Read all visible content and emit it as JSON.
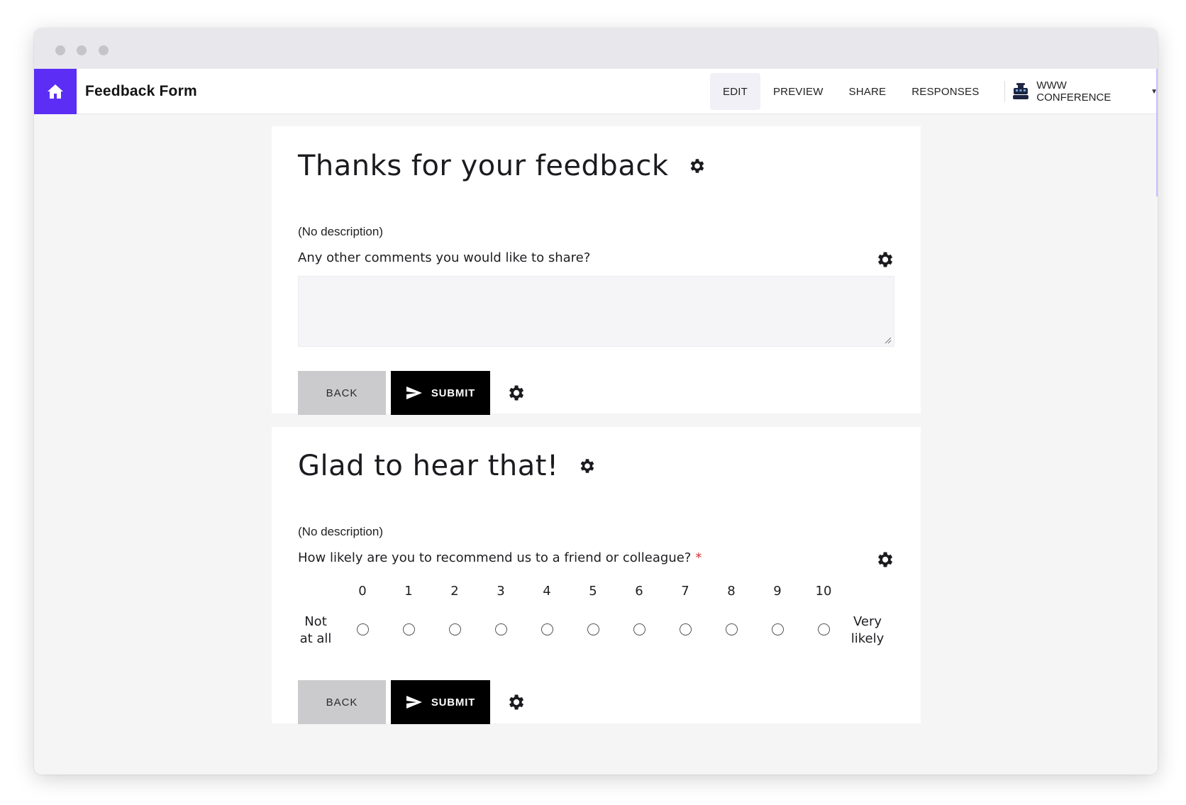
{
  "header": {
    "title": "Feedback Form",
    "tabs": [
      {
        "label": "EDIT",
        "active": true
      },
      {
        "label": "PREVIEW",
        "active": false
      },
      {
        "label": "SHARE",
        "active": false
      },
      {
        "label": "RESPONSES",
        "active": false
      }
    ],
    "workspace": "WWW CONFERENCE"
  },
  "colors": {
    "brand": "#5b2df5",
    "submit_bg": "#000000",
    "back_bg": "#cbcbcd",
    "required": "#d32f2f"
  },
  "pages": [
    {
      "title": "Thanks for your feedback",
      "description": "(No description)",
      "question": "Any other comments you would like to share?",
      "back_label": "BACK",
      "submit_label": "SUBMIT"
    },
    {
      "title": "Glad to hear that!",
      "description": "(No description)",
      "question": "How likely are you to recommend us to a friend or colleague?",
      "required_mark": "*",
      "scale": {
        "values": [
          "0",
          "1",
          "2",
          "3",
          "4",
          "5",
          "6",
          "7",
          "8",
          "9",
          "10"
        ],
        "low_label_1": "Not",
        "low_label_2": "at all",
        "high_label_1": "Very",
        "high_label_2": "likely"
      },
      "back_label": "BACK",
      "submit_label": "SUBMIT"
    }
  ]
}
